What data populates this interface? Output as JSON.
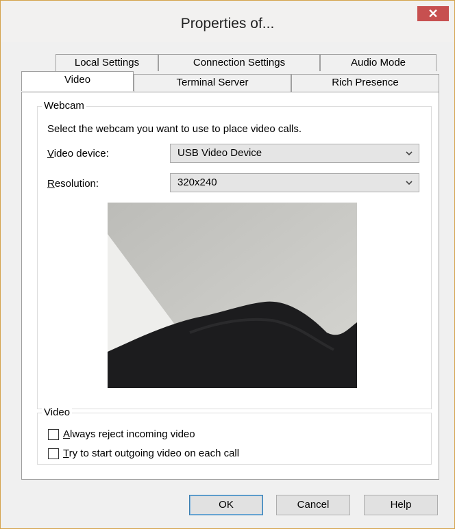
{
  "window": {
    "title": "Properties of...",
    "close_glyph": "✕"
  },
  "tabs": {
    "back_row": [
      "Local Settings",
      "Connection Settings",
      "Audio Mode"
    ],
    "front_row": [
      "Video",
      "Terminal Server",
      "Rich Presence"
    ],
    "active": "Video"
  },
  "webcam": {
    "group_title": "Webcam",
    "instruction": "Select the webcam you want to use to place video calls.",
    "device_label_first": "V",
    "device_label_rest": "ideo device:",
    "device_value": "USB Video Device",
    "resolution_label_first": "R",
    "resolution_label_rest": "esolution:",
    "resolution_value": "320x240"
  },
  "video": {
    "group_title": "Video",
    "option1_first": "A",
    "option1_rest": "lways reject incoming video",
    "option1_checked": false,
    "option2_first": "T",
    "option2_rest": "ry to start outgoing video on each call",
    "option2_checked": false
  },
  "buttons": {
    "ok": "OK",
    "cancel": "Cancel",
    "help": "Help"
  },
  "icons": {
    "dropdown": "chevron-down-icon",
    "close": "close-icon"
  },
  "colors": {
    "close_button": "#c75050",
    "border_accent": "#d4a24a",
    "default_button_border": "#3c7fb1"
  }
}
